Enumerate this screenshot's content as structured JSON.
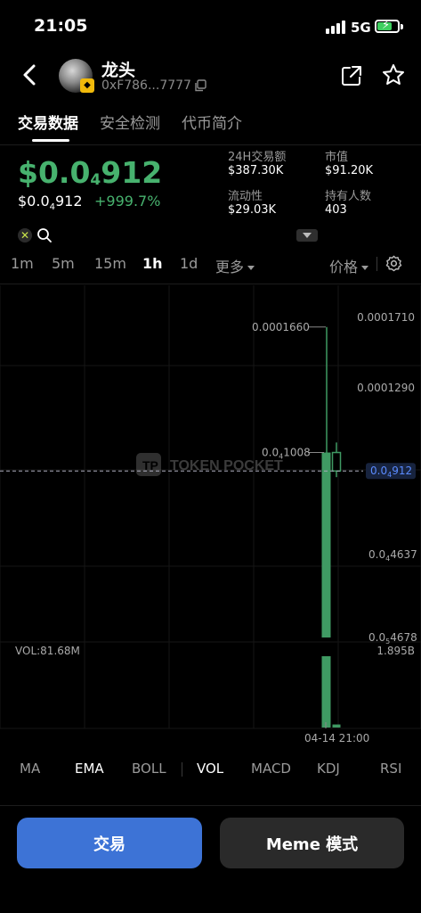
{
  "status_bar": {
    "time": "21:05",
    "network": "5G"
  },
  "header": {
    "token_name": "龙头",
    "address": "0xF786...7777",
    "icons": [
      "back-arrow-icon",
      "copy-icon",
      "share-icon",
      "star-icon"
    ]
  },
  "tabs": [
    {
      "label": "交易数据",
      "active": true
    },
    {
      "label": "安全检测",
      "active": false
    },
    {
      "label": "代币简介",
      "active": false
    }
  ],
  "price": {
    "main_prefix": "$0.0",
    "main_sub": "4",
    "main_suffix": "912",
    "secondary_prefix": "$0.0",
    "secondary_sub": "4",
    "secondary_suffix": "912",
    "change": "+999.7%",
    "color_up": "#47b26e"
  },
  "stats": [
    {
      "label": "24H交易额",
      "value": "$387.30K"
    },
    {
      "label": "市值",
      "value": "$91.20K"
    },
    {
      "label": "流动性",
      "value": "$29.03K"
    },
    {
      "label": "持有人数",
      "value": "403"
    }
  ],
  "intervals": [
    {
      "label": "1m",
      "active": false
    },
    {
      "label": "5m",
      "active": false
    },
    {
      "label": "15m",
      "active": false
    },
    {
      "label": "1h",
      "active": true
    },
    {
      "label": "1d",
      "active": false
    }
  ],
  "more_label": "更多",
  "price_type_label": "价格",
  "chart_data": {
    "type": "candlestick",
    "watermark": "TOKEN POCKET",
    "price_axis_labels": [
      {
        "prefix": "0.0001710",
        "sub": "",
        "suffix": ""
      },
      {
        "prefix": "0.0001290",
        "sub": "",
        "suffix": ""
      },
      {
        "prefix": "0.0",
        "sub": "4",
        "suffix": "4637"
      },
      {
        "prefix": "0.0",
        "sub": "5",
        "suffix": "4678"
      }
    ],
    "current_price": {
      "prefix": "0.0",
      "sub": "4",
      "suffix": "912"
    },
    "high_marker": "0.0001660",
    "low_marker": {
      "prefix": "0.0",
      "sub": "4",
      "suffix": "1008"
    },
    "volume_label": "VOL:81.68M",
    "volume_axis_max": "1.895B",
    "time_label": "04-14 21:00",
    "candles": [
      {
        "open": 4.68e-06,
        "close": 0.0001008,
        "high": 0.000166,
        "low": 4.68e-06,
        "volume": 1895000000
      },
      {
        "open": 0.0001008,
        "close": 9.12e-05,
        "high": 0.000106,
        "low": 8.8e-05,
        "volume": 81680000
      }
    ],
    "up_color": "#3f9a63",
    "grid": true
  },
  "indicators": [
    {
      "label": "MA",
      "active": false
    },
    {
      "label": "EMA",
      "active": true
    },
    {
      "label": "BOLL",
      "active": false
    },
    {
      "label": "VOL",
      "active": true
    },
    {
      "label": "MACD",
      "active": false
    },
    {
      "label": "KDJ",
      "active": false
    },
    {
      "label": "RSI",
      "active": false
    }
  ],
  "buttons": {
    "trade": "交易",
    "meme": "Meme 模式"
  }
}
